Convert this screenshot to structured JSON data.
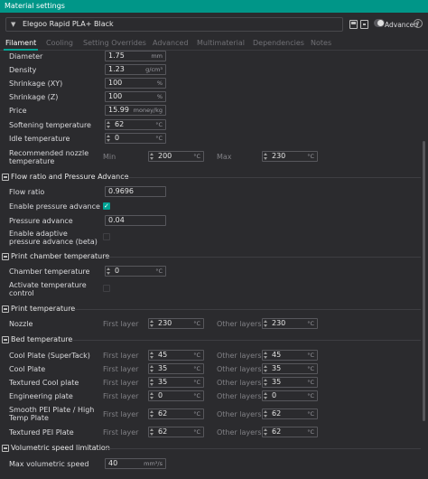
{
  "window": {
    "title": "Material settings"
  },
  "toolbar": {
    "preset_name": "Elegoo Rapid PLA+ Black",
    "advanced_label": "Advanced",
    "help_label": "?"
  },
  "tabs": [
    {
      "label": "Filament",
      "active": true
    },
    {
      "label": "Cooling"
    },
    {
      "label": "Setting Overrides"
    },
    {
      "label": "Advanced"
    },
    {
      "label": "Multimaterial"
    },
    {
      "label": "Dependencies"
    },
    {
      "label": "Notes"
    }
  ],
  "basic": {
    "diameter": {
      "label": "Diameter",
      "value": "1.75",
      "unit": "mm"
    },
    "density": {
      "label": "Density",
      "value": "1.23",
      "unit": "g/cm³"
    },
    "shrink_xy": {
      "label": "Shrinkage (XY)",
      "value": "100",
      "unit": "%"
    },
    "shrink_z": {
      "label": "Shrinkage (Z)",
      "value": "100",
      "unit": "%"
    },
    "price": {
      "label": "Price",
      "value": "15.99",
      "unit": "money/kg"
    },
    "softening": {
      "label": "Softening temperature",
      "value": "62",
      "unit": "°C"
    },
    "idle": {
      "label": "Idle temperature",
      "value": "0",
      "unit": "°C"
    },
    "nozzle_range": {
      "label": "Recommended nozzle temperature",
      "min_label": "Min",
      "min_value": "200",
      "min_unit": "°C",
      "max_label": "Max",
      "max_value": "230",
      "max_unit": "°C"
    }
  },
  "flow": {
    "title": "Flow ratio and Pressure Advance",
    "flow_ratio": {
      "label": "Flow ratio",
      "value": "0.9696"
    },
    "enable_pa": {
      "label": "Enable pressure advance",
      "checked": true
    },
    "pa": {
      "label": "Pressure advance",
      "value": "0.04"
    },
    "adaptive_pa": {
      "label": "Enable adaptive pressure advance (beta)",
      "checked": false
    }
  },
  "chamber": {
    "title": "Print chamber temperature",
    "temp": {
      "label": "Chamber temperature",
      "value": "0",
      "unit": "°C"
    },
    "activate": {
      "label": "Activate temperature control",
      "checked": false
    }
  },
  "print_temp": {
    "title": "Print temperature",
    "nozzle": {
      "label": "Nozzle",
      "first_label": "First layer",
      "first": "230",
      "other_label": "Other layers",
      "other": "230",
      "unit": "°C"
    }
  },
  "bed": {
    "title": "Bed temperature",
    "first_label": "First layer",
    "other_label": "Other layers",
    "unit": "°C",
    "rows": [
      {
        "label": "Cool Plate (SuperTack)",
        "first": "45",
        "other": "45"
      },
      {
        "label": "Cool Plate",
        "first": "35",
        "other": "35"
      },
      {
        "label": "Textured Cool plate",
        "first": "35",
        "other": "35"
      },
      {
        "label": "Engineering plate",
        "first": "0",
        "other": "0"
      },
      {
        "label": "Smooth PEI Plate / High Temp Plate",
        "first": "62",
        "other": "62"
      },
      {
        "label": "Textured PEI Plate",
        "first": "62",
        "other": "62"
      }
    ]
  },
  "volumetric": {
    "title": "Volumetric speed limitation",
    "max": {
      "label": "Max volumetric speed",
      "value": "40",
      "unit": "mm³/s"
    }
  }
}
